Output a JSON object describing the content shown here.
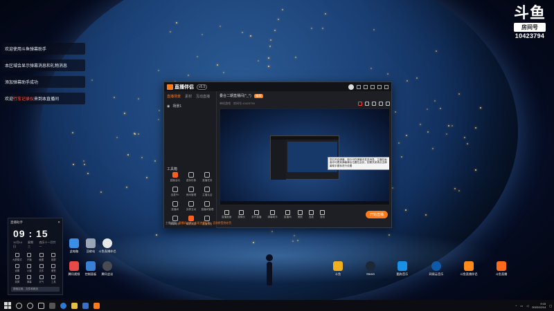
{
  "logo": {
    "mark": "斗鱼",
    "sub": "房间号",
    "room_number": "10423794"
  },
  "chat": [
    {
      "text": "欢迎使用斗鱼弹幕助手"
    },
    {
      "text": "本区域会显示弹幕消息和礼物消息"
    },
    {
      "text": "添加弹幕助手成功"
    },
    {
      "pre": "欢迎",
      "highlight": "行车记录仪",
      "post": "来到本直播间"
    }
  ],
  "app": {
    "name": "直播伴侣",
    "badge": "v5.5",
    "left_tabs": [
      "直播场景",
      "素材",
      "互动直播"
    ],
    "scene": "场景1",
    "section_title": "工具箱",
    "tools": [
      "直播活动",
      "虚拟形象",
      "直播任务",
      "连麦PK",
      "房间管理",
      "主播认证",
      "直播间",
      "多屏互动",
      "直播间管理",
      "弹幕助手",
      "最新消息",
      "直播预告"
    ],
    "stream_title": "叠合二期直播间(^_^)",
    "stream_tag": "编辑",
    "stream_category": "单机游戏",
    "room_info": "房间号:10423794",
    "tooltip": "您已开启弹幕，观众可在弹幕中发送消息，主播在画面中可看到弹幕弹出位置在此处，如需关闭请点击弹幕助手图标进行设置",
    "bottom_tools": [
      "直播画面",
      "摄像头",
      "多开直播",
      "弹幕助手",
      "直播间",
      "美颜",
      "连麦",
      "音效"
    ],
    "go_live": "开始直播",
    "status_pre": "主播须知：",
    "status_warn": "直播间内禁止出现违规行为，否则将受到处罚"
  },
  "clock": {
    "title": "直播助手",
    "time": "09 : 15",
    "date": "12月14日",
    "weekday": "星期三",
    "lunar": "农历十一月廿一",
    "grid": [
      "大屏模式",
      "开播",
      "截图",
      "投屏",
      "设置",
      "小窗",
      "文件",
      "便签",
      "录屏",
      "弹幕",
      "天气",
      "工具"
    ],
    "search": "搜索应用、文件和网页"
  },
  "desktop_icons": [
    {
      "label": "此电脑",
      "color": "#3b8ee6"
    },
    {
      "label": "回收站",
      "color": "#9aa6b8"
    },
    {
      "label": "斗鱼直播伴侣",
      "color": "#e8e8e8"
    },
    {
      "label": "腾讯视频",
      "color": "#e84a4a"
    },
    {
      "label": "控制面板",
      "color": "#3a7fd6"
    },
    {
      "label": "腾讯会议",
      "color": "#4a4a52"
    },
    {
      "label": "斗鱼",
      "color": "#f0b020"
    },
    {
      "label": "Steam",
      "color": "#1b2838"
    },
    {
      "label": "酷狗音乐",
      "color": "#1a8fe6"
    },
    {
      "label": "网易云音乐",
      "color": "#0f5aa8"
    },
    {
      "label": "斗鱼直播伴侣",
      "color": "#ff8a1a"
    },
    {
      "label": "斗鱼直播",
      "color": "#ff6a1a"
    }
  ],
  "taskbar": {
    "time": "9:15",
    "date": "2022/12/14"
  }
}
